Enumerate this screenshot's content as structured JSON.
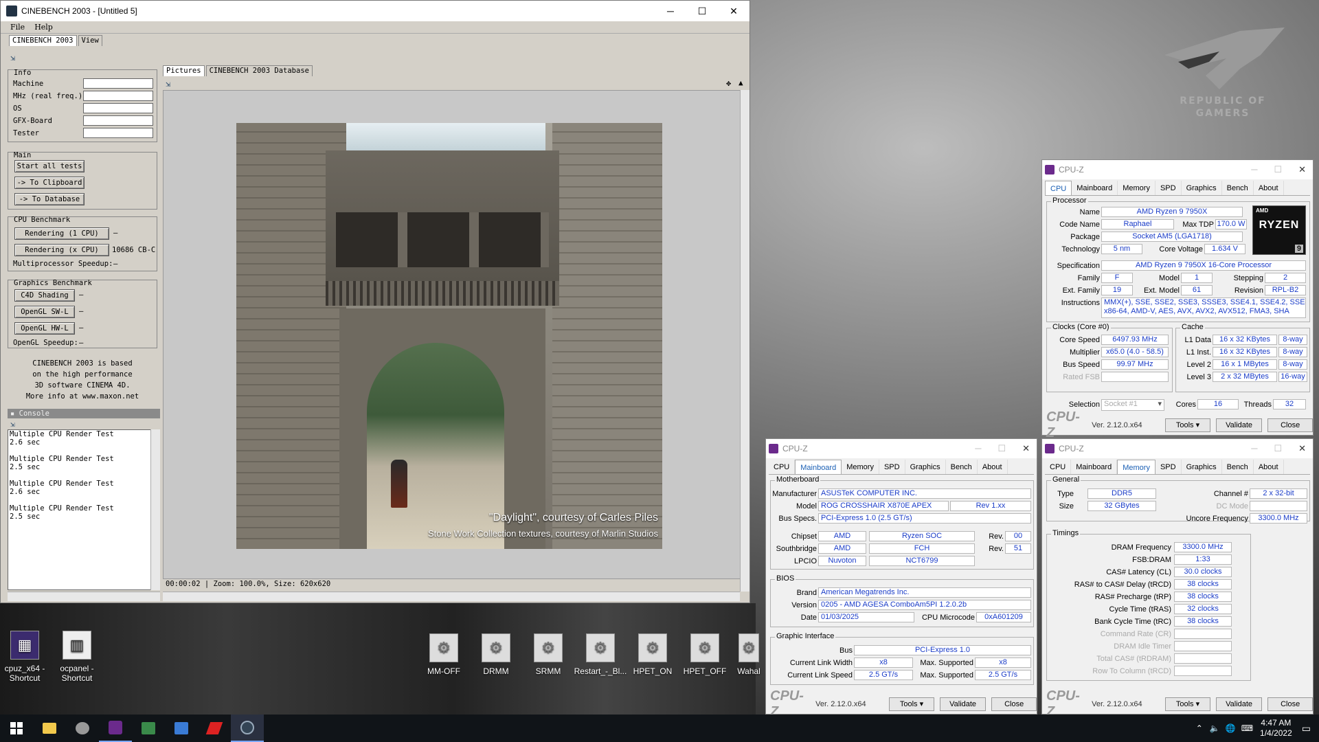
{
  "desktop": {
    "brand_line1": "REPUBLIC OF",
    "brand_line2": "GAMERS",
    "icons_left": [
      {
        "label": "cpuz_x64 -\nShortcut",
        "icon": "cpuz-icon"
      },
      {
        "label": "ocpanel -\nShortcut",
        "icon": "ocpanel-icon"
      }
    ],
    "icons_row": [
      "MM-OFF",
      "DRMM",
      "SRMM",
      "Restart_-_Bl...",
      "HPET_ON",
      "HPET_OFF",
      "Wahal"
    ]
  },
  "cinebench": {
    "title": "CINEBENCH 2003 - [Untitled 5]",
    "menu": [
      "File",
      "Help"
    ],
    "top_tabs": [
      "CINEBENCH 2003",
      "View"
    ],
    "info": {
      "label": "Info",
      "fields": [
        "Machine",
        "MHz (real freq.)",
        "OS",
        "GFX-Board",
        "Tester"
      ]
    },
    "main": {
      "label": "Main",
      "buttons": [
        "Start all tests",
        "-> To Clipboard",
        "-> To Database"
      ]
    },
    "cpu_bench": {
      "label": "CPU Benchmark",
      "btn1": "Rendering (1 CPU)",
      "btn1_result": "—",
      "btn2": "Rendering (x CPU)",
      "btn2_result": "10686 CB-C",
      "speedup_label": "Multiprocessor Speedup:",
      "speedup_value": "—"
    },
    "gfx_bench": {
      "label": "Graphics Benchmark",
      "buttons": [
        "C4D Shading",
        "OpenGL SW-L",
        "OpenGL HW-L"
      ],
      "results": [
        "—",
        "—",
        "—"
      ],
      "speedup_label": "OpenGL Speedup:",
      "speedup_value": "—"
    },
    "about_text": [
      "CINEBENCH 2003 is based",
      "on the high performance",
      "3D software CINEMA 4D.",
      "More info at www.maxon.net"
    ],
    "console_label": "Console",
    "console_lines": [
      [
        "Multiple CPU Render Test",
        "2.6 sec"
      ],
      [
        "Multiple CPU Render Test",
        "2.5 sec"
      ],
      [
        "Multiple CPU Render Test",
        "2.6 sec"
      ],
      [
        "Multiple CPU Render Test",
        "2.5 sec"
      ]
    ],
    "view_tabs": [
      "Pictures",
      "CINEBENCH 2003 Database"
    ],
    "caption1": "\"Daylight\", courtesy of Carles Piles",
    "caption2": "Stone Work Collection textures, courtesy of Marlin Studios",
    "status": "00:00:02 | Zoom: 100.0%, Size: 620x620"
  },
  "cpuz_common": {
    "title": "CPU-Z",
    "tabs": [
      "CPU",
      "Mainboard",
      "Memory",
      "SPD",
      "Graphics",
      "Bench",
      "About"
    ],
    "logo": "CPU-Z",
    "version": "Ver. 2.12.0.x64",
    "tools": "Tools",
    "validate": "Validate",
    "close": "Close"
  },
  "cpuz_cpu": {
    "processor_label": "Processor",
    "name_label": "Name",
    "name": "AMD Ryzen 9 7950X",
    "codename_label": "Code Name",
    "codename": "Raphael",
    "maxtdp_label": "Max TDP",
    "maxtdp": "170.0 W",
    "package_label": "Package",
    "package": "Socket AM5 (LGA1718)",
    "tech_label": "Technology",
    "tech": "5 nm",
    "voltage_label": "Core Voltage",
    "voltage": "1.634 V",
    "spec_label": "Specification",
    "spec": "AMD Ryzen 9 7950X 16-Core Processor",
    "family_label": "Family",
    "family": "F",
    "model_label": "Model",
    "model": "1",
    "stepping_label": "Stepping",
    "stepping": "2",
    "extfamily_label": "Ext. Family",
    "extfamily": "19",
    "extmodel_label": "Ext. Model",
    "extmodel": "61",
    "revision_label": "Revision",
    "revision": "RPL-B2",
    "instr_label": "Instructions",
    "instr1": "MMX(+), SSE, SSE2, SSE3, SSSE3, SSE4.1, SSE4.2, SSE4A,",
    "instr2": "x86-64, AMD-V, AES, AVX, AVX2, AVX512, FMA3, SHA",
    "badge_amd": "AMD",
    "badge_ryzen": "RYZEN",
    "badge_9": "9",
    "clocks_label": "Clocks (Core #0)",
    "corespeed_label": "Core Speed",
    "corespeed": "6497.93 MHz",
    "mult_label": "Multiplier",
    "mult": "x65.0 (4.0 - 58.5)",
    "bus_label": "Bus Speed",
    "bus": "99.97 MHz",
    "ratedfsb_label": "Rated FSB",
    "cache_label": "Cache",
    "l1d_label": "L1 Data",
    "l1d": "16 x 32 KBytes",
    "l1d_way": "8-way",
    "l1i_label": "L1 Inst.",
    "l1i": "16 x 32 KBytes",
    "l1i_way": "8-way",
    "l2_label": "Level 2",
    "l2": "16 x 1 MBytes",
    "l2_way": "8-way",
    "l3_label": "Level 3",
    "l3": "2 x 32 MBytes",
    "l3_way": "16-way",
    "selection_label": "Selection",
    "selection": "Socket #1",
    "cores_label": "Cores",
    "cores": "16",
    "threads_label": "Threads",
    "threads": "32"
  },
  "cpuz_mb": {
    "mb_label": "Motherboard",
    "mfr_label": "Manufacturer",
    "mfr": "ASUSTeK COMPUTER INC.",
    "model_label": "Model",
    "model": "ROG CROSSHAIR X870E APEX",
    "rev": "Rev 1.xx",
    "busspec_label": "Bus Specs.",
    "busspec": "PCI-Express 1.0 (2.5 GT/s)",
    "chipset_label": "Chipset",
    "chipset_v": "AMD",
    "chipset_n": "Ryzen SOC",
    "rev_label": "Rev.",
    "chipset_rev": "00",
    "sb_label": "Southbridge",
    "sb_v": "AMD",
    "sb_n": "FCH",
    "sb_rev": "51",
    "lpcio_label": "LPCIO",
    "lpcio_v": "Nuvoton",
    "lpcio_n": "NCT6799",
    "bios_label": "BIOS",
    "brand_label": "Brand",
    "brand": "American Megatrends Inc.",
    "version_label": "Version",
    "version": "0205 - AMD AGESA ComboAm5PI 1.2.0.2b",
    "date_label": "Date",
    "date": "01/03/2025",
    "microcode_label": "CPU Microcode",
    "microcode": "0xA601209",
    "gi_label": "Graphic Interface",
    "gbus_label": "Bus",
    "gbus": "PCI-Express 1.0",
    "clw_label": "Current Link Width",
    "clw": "x8",
    "mlw_label": "Max. Supported",
    "mlw": "x8",
    "cls_label": "Current Link Speed",
    "cls": "2.5 GT/s",
    "mls_label": "Max. Supported",
    "mls": "2.5 GT/s"
  },
  "cpuz_mem": {
    "general_label": "General",
    "type_label": "Type",
    "type": "DDR5",
    "channel_label": "Channel #",
    "channel": "2 x 32-bit",
    "size_label": "Size",
    "size": "32 GBytes",
    "dcmode_label": "DC Mode",
    "uncore_label": "Uncore Frequency",
    "uncore": "3300.0 MHz",
    "timings_label": "Timings",
    "rows": [
      {
        "label": "DRAM Frequency",
        "value": "3300.0 MHz"
      },
      {
        "label": "FSB:DRAM",
        "value": "1:33"
      },
      {
        "label": "CAS# Latency (CL)",
        "value": "30.0 clocks"
      },
      {
        "label": "RAS# to CAS# Delay (tRCD)",
        "value": "38 clocks"
      },
      {
        "label": "RAS# Precharge (tRP)",
        "value": "38 clocks"
      },
      {
        "label": "Cycle Time (tRAS)",
        "value": "32 clocks"
      },
      {
        "label": "Bank Cycle Time (tRC)",
        "value": "38 clocks"
      },
      {
        "label": "Command Rate (CR)",
        "value": ""
      },
      {
        "label": "DRAM Idle Timer",
        "value": ""
      },
      {
        "label": "Total CAS# (tRDRAM)",
        "value": ""
      },
      {
        "label": "Row To Column (tRCD)",
        "value": ""
      }
    ]
  },
  "taskbar": {
    "time": "4:47 AM",
    "date": "1/4/2022"
  }
}
